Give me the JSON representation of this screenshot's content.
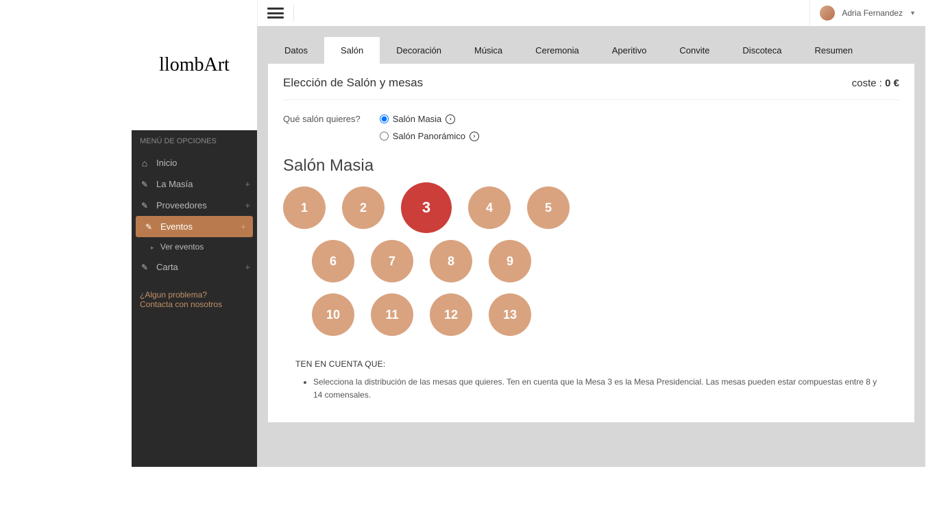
{
  "brand": {
    "name": "llombArt"
  },
  "header": {
    "username": "Adria Fernandez"
  },
  "sidebar": {
    "menu_header": "MENÚ DE OPCIONES",
    "items": [
      {
        "label": "Inicio",
        "icon": "home",
        "expandable": false
      },
      {
        "label": "La Masía",
        "icon": "edit",
        "expandable": true
      },
      {
        "label": "Proveedores",
        "icon": "edit",
        "expandable": true
      },
      {
        "label": "Eventos",
        "icon": "edit",
        "expandable": true,
        "active": true,
        "submenu": [
          {
            "label": "Ver eventos"
          }
        ]
      },
      {
        "label": "Carta",
        "icon": "edit",
        "expandable": true
      }
    ],
    "footer": {
      "problem": "¿Algun problema?",
      "contact": "Contacta con nosotros"
    }
  },
  "tabs": [
    {
      "label": "Datos"
    },
    {
      "label": "Salón",
      "active": true
    },
    {
      "label": "Decoración"
    },
    {
      "label": "Música"
    },
    {
      "label": "Ceremonia"
    },
    {
      "label": "Aperitivo"
    },
    {
      "label": "Convite"
    },
    {
      "label": "Discoteca"
    },
    {
      "label": "Resumen"
    }
  ],
  "panel": {
    "title": "Elección de Salón y mesas",
    "cost_label": "coste : ",
    "cost_value": "0 €",
    "question": "Qué salón quieres?",
    "options": [
      {
        "label": "Salón Masia",
        "checked": true
      },
      {
        "label": "Salón Panorámico",
        "checked": false
      }
    ],
    "salon_title": "Salón Masia",
    "tables": {
      "rows": [
        [
          {
            "n": "1"
          },
          {
            "n": "2"
          },
          {
            "n": "3",
            "selected": true
          },
          {
            "n": "4"
          },
          {
            "n": "5"
          }
        ],
        [
          {
            "n": "6"
          },
          {
            "n": "7"
          },
          {
            "n": "8"
          },
          {
            "n": "9"
          }
        ],
        [
          {
            "n": "10"
          },
          {
            "n": "11"
          },
          {
            "n": "12"
          },
          {
            "n": "13"
          }
        ]
      ]
    },
    "notes": {
      "title": "TEN EN CUENTA QUE:",
      "items": [
        "Selecciona la distribución de las mesas que quieres. Ten en cuenta que la Mesa 3 es la Mesa Presidencial. Las mesas pueden estar compuestas  entre 8 y 14 comensales."
      ]
    }
  }
}
